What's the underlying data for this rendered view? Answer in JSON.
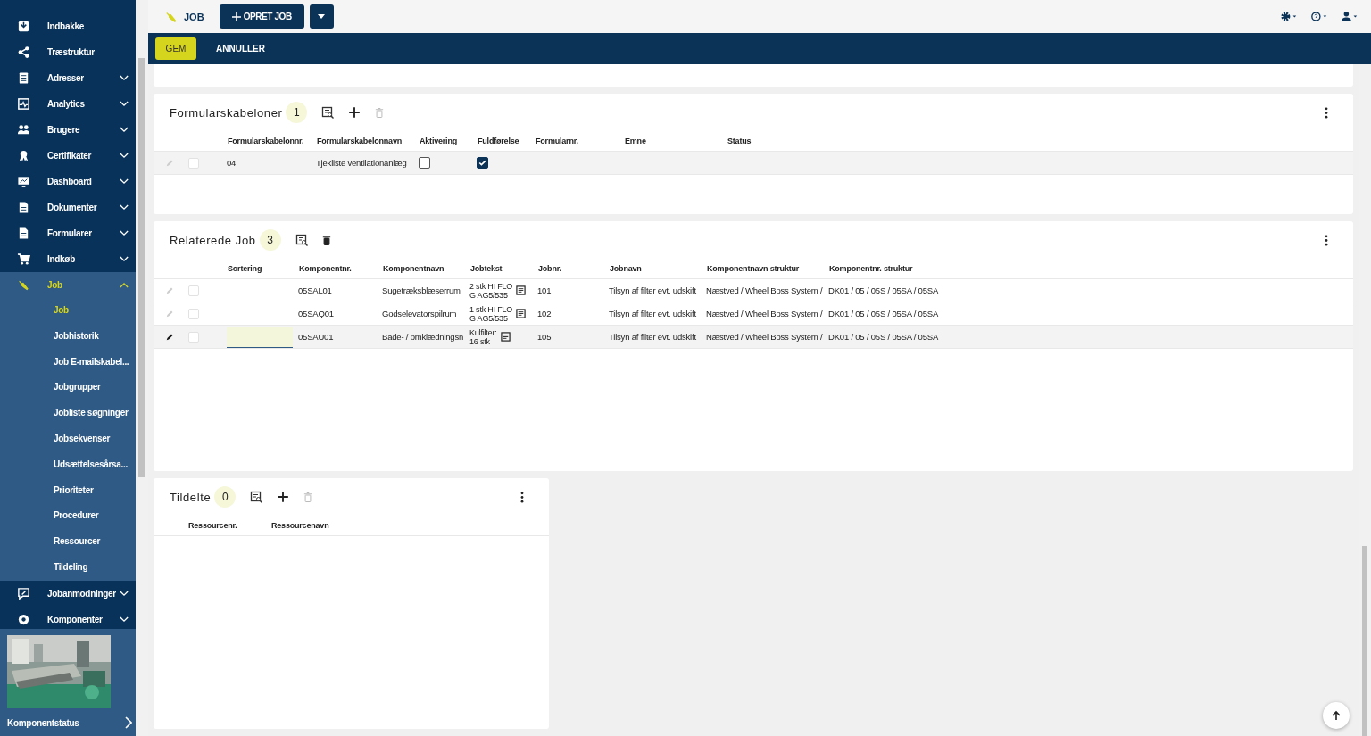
{
  "sidebar": {
    "items": [
      {
        "label": "Indbakke",
        "expandable": false,
        "expanded": false
      },
      {
        "label": "Træstruktur",
        "expandable": false,
        "expanded": false
      },
      {
        "label": "Adresser",
        "expandable": true,
        "expanded": false
      },
      {
        "label": "Analytics",
        "expandable": true,
        "expanded": false
      },
      {
        "label": "Brugere",
        "expandable": true,
        "expanded": false
      },
      {
        "label": "Certifikater",
        "expandable": true,
        "expanded": false
      },
      {
        "label": "Dashboard",
        "expandable": true,
        "expanded": false
      },
      {
        "label": "Dokumenter",
        "expandable": true,
        "expanded": false
      },
      {
        "label": "Formularer",
        "expandable": true,
        "expanded": false
      },
      {
        "label": "Indkøb",
        "expandable": true,
        "expanded": false
      },
      {
        "label": "Job",
        "expandable": true,
        "expanded": true,
        "children": [
          {
            "label": "Job",
            "selected": true
          },
          {
            "label": "Jobhistorik",
            "selected": false
          },
          {
            "label": "Job E-mailskabel...",
            "selected": false
          },
          {
            "label": "Jobgrupper",
            "selected": false
          },
          {
            "label": "Jobliste søgninger",
            "selected": false
          },
          {
            "label": "Jobsekvenser",
            "selected": false
          },
          {
            "label": "Udsættelsesårsa...",
            "selected": false
          },
          {
            "label": "Prioriteter",
            "selected": false
          },
          {
            "label": "Procedurer",
            "selected": false
          },
          {
            "label": "Ressourcer",
            "selected": false
          },
          {
            "label": "Tildeling",
            "selected": false
          }
        ]
      },
      {
        "label": "Jobanmodninger",
        "expandable": true,
        "expanded": false
      },
      {
        "label": "Komponenter",
        "expandable": true,
        "expanded": false
      }
    ],
    "widget": {
      "kind": "picture",
      "label": "Komponentstatus"
    }
  },
  "topbar": {
    "title": "JOB",
    "create_button": "OPRET JOB"
  },
  "actionbar": {
    "save": "GEM",
    "cancel": "ANNULLER"
  },
  "forms": {
    "title": "Formularskabeloner",
    "count": "1",
    "can_add": true,
    "can_delete": false,
    "columns": [
      "Formularskabelonnr.",
      "Formularskabelonnavn",
      "Aktivering",
      "Fuldførelse",
      "Formularnr.",
      "Emne",
      "Status"
    ],
    "rows": [
      {
        "selected": true,
        "checked": false,
        "nr": "04",
        "name": "Tjekliste ventilationanlæg",
        "activation": false,
        "completion": true
      }
    ]
  },
  "related": {
    "title": "Relaterede Job",
    "count": "3",
    "can_add": false,
    "can_delete": true,
    "columns": [
      "Sortering",
      "Komponentnr.",
      "Komponentnavn",
      "Jobtekst",
      "Jobnr.",
      "Jobnavn",
      "Komponentnavn struktur",
      "Komponentnr. struktur"
    ],
    "rows": [
      {
        "selected": false,
        "editing": false,
        "checked": false,
        "component_no": "05SAL01",
        "component_name": "Sugetræksblæserrum",
        "job_text": [
          "2 stk HI FLO",
          "G AG5/535"
        ],
        "job_no": "101",
        "job_name": "Tilsyn af filter evt. udskift",
        "name_structure": "Næstved / Wheel Boss System /",
        "no_structure": "DK01 / 05 / 05S / 05SA / 05SA"
      },
      {
        "selected": false,
        "editing": false,
        "checked": false,
        "component_no": "05SAQ01",
        "component_name": "Godselevatorspilrum",
        "job_text": [
          "1 stk HI FLO",
          "G AG5/535"
        ],
        "job_no": "102",
        "job_name": "Tilsyn af filter evt. udskift",
        "name_structure": "Næstved / Wheel Boss System /",
        "no_structure": "DK01 / 05 / 05S / 05SA / 05SA"
      },
      {
        "selected": true,
        "editing": true,
        "checked": false,
        "component_no": "05SAU01",
        "component_name": "Bade- / omklædningsn",
        "job_text": [
          "Kulfilter:",
          "16 stk"
        ],
        "job_no": "105",
        "job_name": "Tilsyn af filter evt. udskift",
        "name_structure": "Næstved / Wheel Boss System /",
        "no_structure": "DK01 / 05 / 05S / 05SA / 05SA"
      }
    ]
  },
  "assigned": {
    "title": "Tildelte",
    "count": "0",
    "can_add": true,
    "can_delete": false,
    "columns": [
      "Ressourcenr.",
      "Ressourcenavn"
    ]
  }
}
